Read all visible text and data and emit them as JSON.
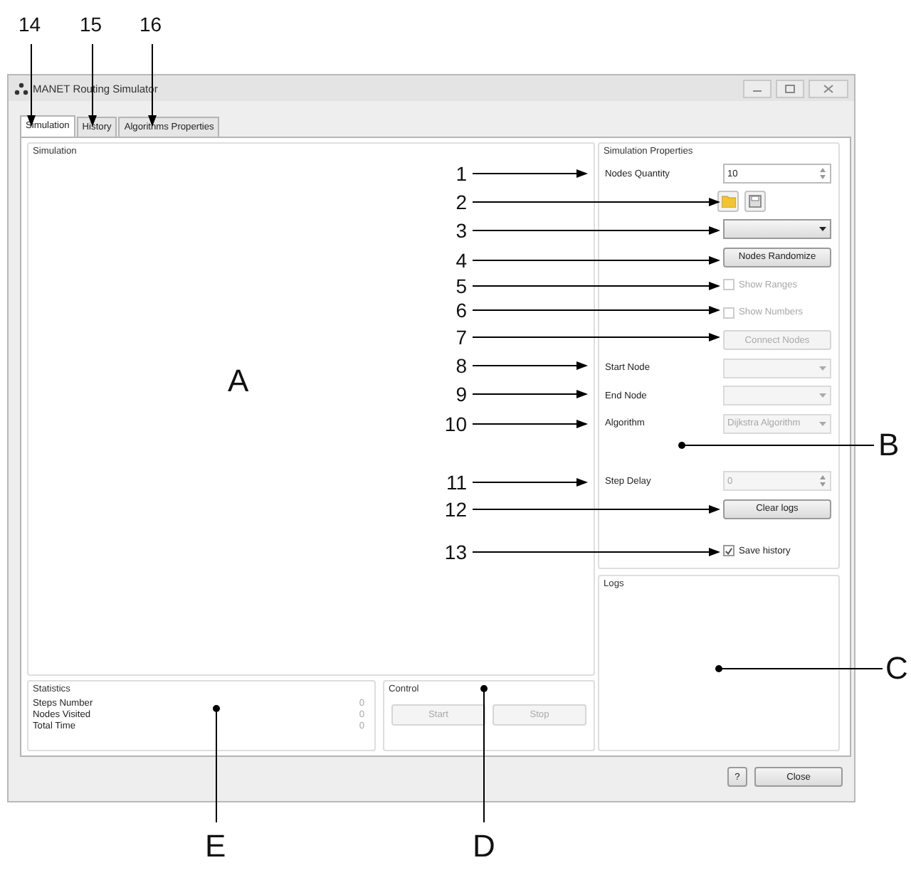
{
  "annotations": {
    "tab_markers": [
      {
        "label": "14"
      },
      {
        "label": "15"
      },
      {
        "label": "16"
      }
    ],
    "callouts": [
      {
        "label": "1"
      },
      {
        "label": "2"
      },
      {
        "label": "3"
      },
      {
        "label": "4"
      },
      {
        "label": "5"
      },
      {
        "label": "6"
      },
      {
        "label": "7"
      },
      {
        "label": "8"
      },
      {
        "label": "9"
      },
      {
        "label": "10"
      },
      {
        "label": "11"
      },
      {
        "label": "12"
      },
      {
        "label": "13"
      }
    ],
    "regions": [
      {
        "label": "A"
      },
      {
        "label": "B"
      },
      {
        "label": "C"
      },
      {
        "label": "D"
      },
      {
        "label": "E"
      }
    ]
  },
  "window": {
    "title": "MANET Routing Simulator"
  },
  "tabs": [
    {
      "label": "Simulation",
      "selected": true
    },
    {
      "label": "History",
      "selected": false
    },
    {
      "label": "Algorithms Properties",
      "selected": false
    }
  ],
  "simulation": {
    "title": "Simulation"
  },
  "properties": {
    "title": "Simulation Properties",
    "rows": [
      {
        "kind": "spinner",
        "label": "Nodes Quantity",
        "value": "10",
        "disabled": false
      },
      {
        "kind": "file_buttons"
      },
      {
        "kind": "combo",
        "disabled": false
      },
      {
        "kind": "button",
        "label": "Nodes Randomize",
        "disabled": false
      },
      {
        "kind": "checkbox",
        "label": "Show Ranges",
        "checked": false,
        "disabled": true
      },
      {
        "kind": "checkbox",
        "label": "Show Numbers",
        "checked": false,
        "disabled": true
      },
      {
        "kind": "button",
        "label": "Connect Nodes",
        "disabled": true
      },
      {
        "kind": "combo",
        "label": "Start Node",
        "disabled": true
      },
      {
        "kind": "combo",
        "label": "End Node",
        "disabled": true
      },
      {
        "kind": "combo",
        "label": "Algorithm",
        "value": "Dijkstra Algorithm",
        "disabled": true
      },
      {
        "kind": "spinner",
        "label": "Step Delay",
        "value": "0",
        "disabled": true
      },
      {
        "kind": "button",
        "label": "Clear logs",
        "disabled": false
      },
      {
        "kind": "checkbox",
        "label": "Save history",
        "checked": true,
        "disabled": false
      }
    ]
  },
  "logs": {
    "title": "Logs"
  },
  "statistics": {
    "title": "Statistics",
    "rows": [
      {
        "label": "Steps Number",
        "value": "0"
      },
      {
        "label": "Nodes Visited",
        "value": "0"
      },
      {
        "label": "Total Time",
        "value": "0"
      }
    ]
  },
  "control": {
    "title": "Control",
    "buttons": [
      {
        "label": "Start",
        "disabled": true
      },
      {
        "label": "Stop",
        "disabled": true
      }
    ]
  },
  "footer": {
    "buttons": [
      {
        "label": "?"
      },
      {
        "label": "Close"
      }
    ]
  }
}
